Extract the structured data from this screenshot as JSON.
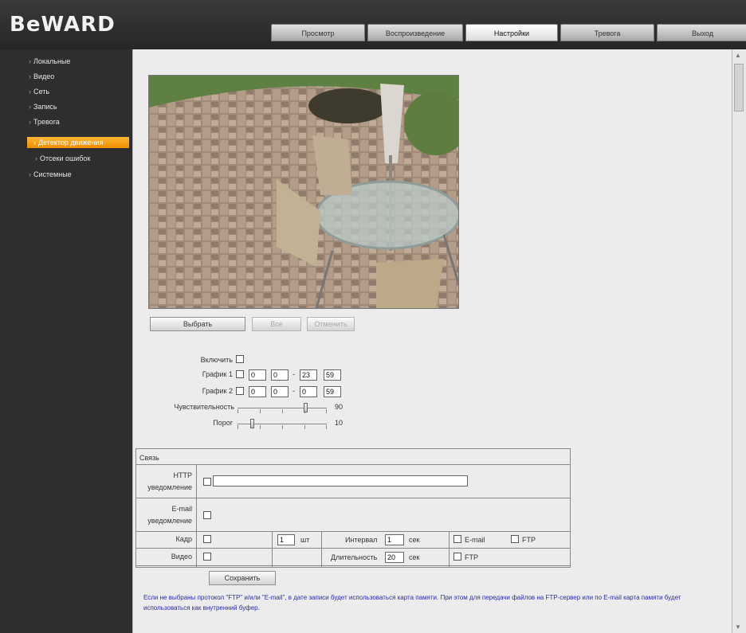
{
  "brand": {
    "logo": "BeWARD"
  },
  "tabs": [
    {
      "label": "Просмотр",
      "active": false
    },
    {
      "label": "Воспроизведение",
      "active": false
    },
    {
      "label": "Настройки",
      "active": true
    },
    {
      "label": "Тревога",
      "active": false
    },
    {
      "label": "Выход",
      "active": false
    }
  ],
  "sidebar": {
    "items": [
      {
        "label": "Локальные"
      },
      {
        "label": "Видео"
      },
      {
        "label": "Сеть"
      },
      {
        "label": "Запись"
      },
      {
        "label": "Тревога"
      },
      {
        "label": "Детектор движения",
        "active": true
      },
      {
        "label": "Отсеки ошибок"
      },
      {
        "label": "Системные"
      }
    ]
  },
  "video_buttons": {
    "select": "Выбрать",
    "clear": "Все",
    "revert": "Отменить"
  },
  "schedule": {
    "enable_label": "Включить",
    "schedule1_label": "График 1",
    "schedule1": {
      "start_h": "0",
      "start_m": "0",
      "end_h": "23",
      "end_m": "59"
    },
    "schedule2_label": "График 2",
    "schedule2": {
      "start_h": "0",
      "start_m": "0",
      "end_h": "0",
      "end_m": "59"
    },
    "range_sep": "-",
    "sensitivity_label": "Чувствительность",
    "sensitivity_value": "90",
    "threshold_label": "Порог",
    "threshold_value": "10"
  },
  "actions": {
    "title": "Связь",
    "http_label": "HTTP уведомление",
    "http_value": "",
    "email_label": "E-mail уведомление",
    "shot_label": "Кадр",
    "shot_count": "1",
    "shot_unit": "шт",
    "interval_label": "Интервал",
    "interval_value": "1",
    "interval_unit": "сек",
    "email_option": "E-mail",
    "ftp_option": "FTP",
    "video_label": "Видео",
    "duration_label": "Длительность",
    "duration_value": "20",
    "duration_unit": "сек",
    "video_ftp_option": "FTP",
    "save_label": "Сохранить"
  },
  "note": "Если не выбраны протокол \"FTP\" и/или \"E-mail\", в дате записи будет использоваться карта памяти. При этом для передачи файлов на FTP-сервер или по E-mail карта памяти будет использоваться как внутренний буфер."
}
